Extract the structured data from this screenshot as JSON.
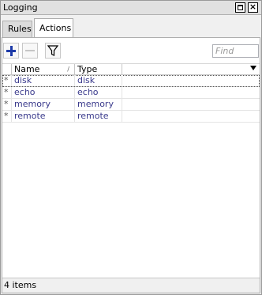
{
  "window": {
    "title": "Logging",
    "close_glyph": "×"
  },
  "tabs": [
    {
      "label": "Rules",
      "active": false
    },
    {
      "label": "Actions",
      "active": true
    }
  ],
  "toolbar": {
    "add_icon": "plus-icon",
    "remove_icon": "minus-icon",
    "filter_icon": "filter-icon",
    "find_placeholder": "Find"
  },
  "table": {
    "columns": [
      "Name",
      "Type"
    ],
    "sort_indicator": "/",
    "rows": [
      {
        "marker": "*",
        "name": "disk",
        "type": "disk"
      },
      {
        "marker": "*",
        "name": "echo",
        "type": "echo"
      },
      {
        "marker": "*",
        "name": "memory",
        "type": "memory"
      },
      {
        "marker": "*",
        "name": "remote",
        "type": "remote"
      }
    ]
  },
  "status": {
    "item_count": "4 items"
  },
  "colors": {
    "accent": "#1d3aa8",
    "link_text": "#3a3a8c"
  }
}
